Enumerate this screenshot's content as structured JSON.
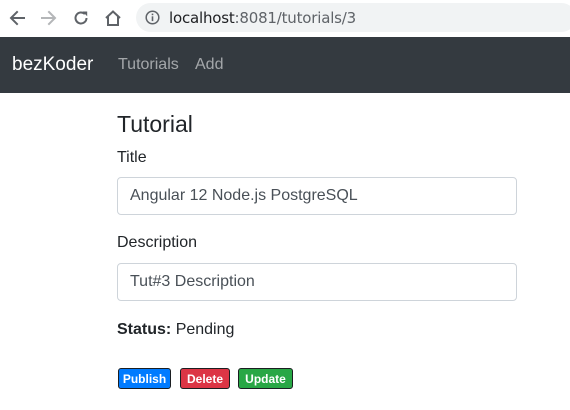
{
  "browser": {
    "url_host": "localhost",
    "url_rest": ":8081/tutorials/3"
  },
  "navbar": {
    "brand": "bezKoder",
    "links": [
      "Tutorials",
      "Add"
    ]
  },
  "tutorial": {
    "heading": "Tutorial",
    "title_label": "Title",
    "title_value": "Angular 12 Node.js PostgreSQL",
    "description_label": "Description",
    "description_value": "Tut#3 Description",
    "status_label": "Status:",
    "status_value": "Pending"
  },
  "actions": {
    "publish": "Publish",
    "delete": "Delete",
    "update": "Update"
  },
  "colors": {
    "navbar_bg": "#343a40",
    "publish": "#007bff",
    "delete": "#dc3545",
    "update": "#28a745"
  },
  "icons": {
    "back": "arrow-left-icon",
    "forward": "arrow-right-icon",
    "reload": "reload-icon",
    "home": "home-icon",
    "info": "info-icon"
  }
}
